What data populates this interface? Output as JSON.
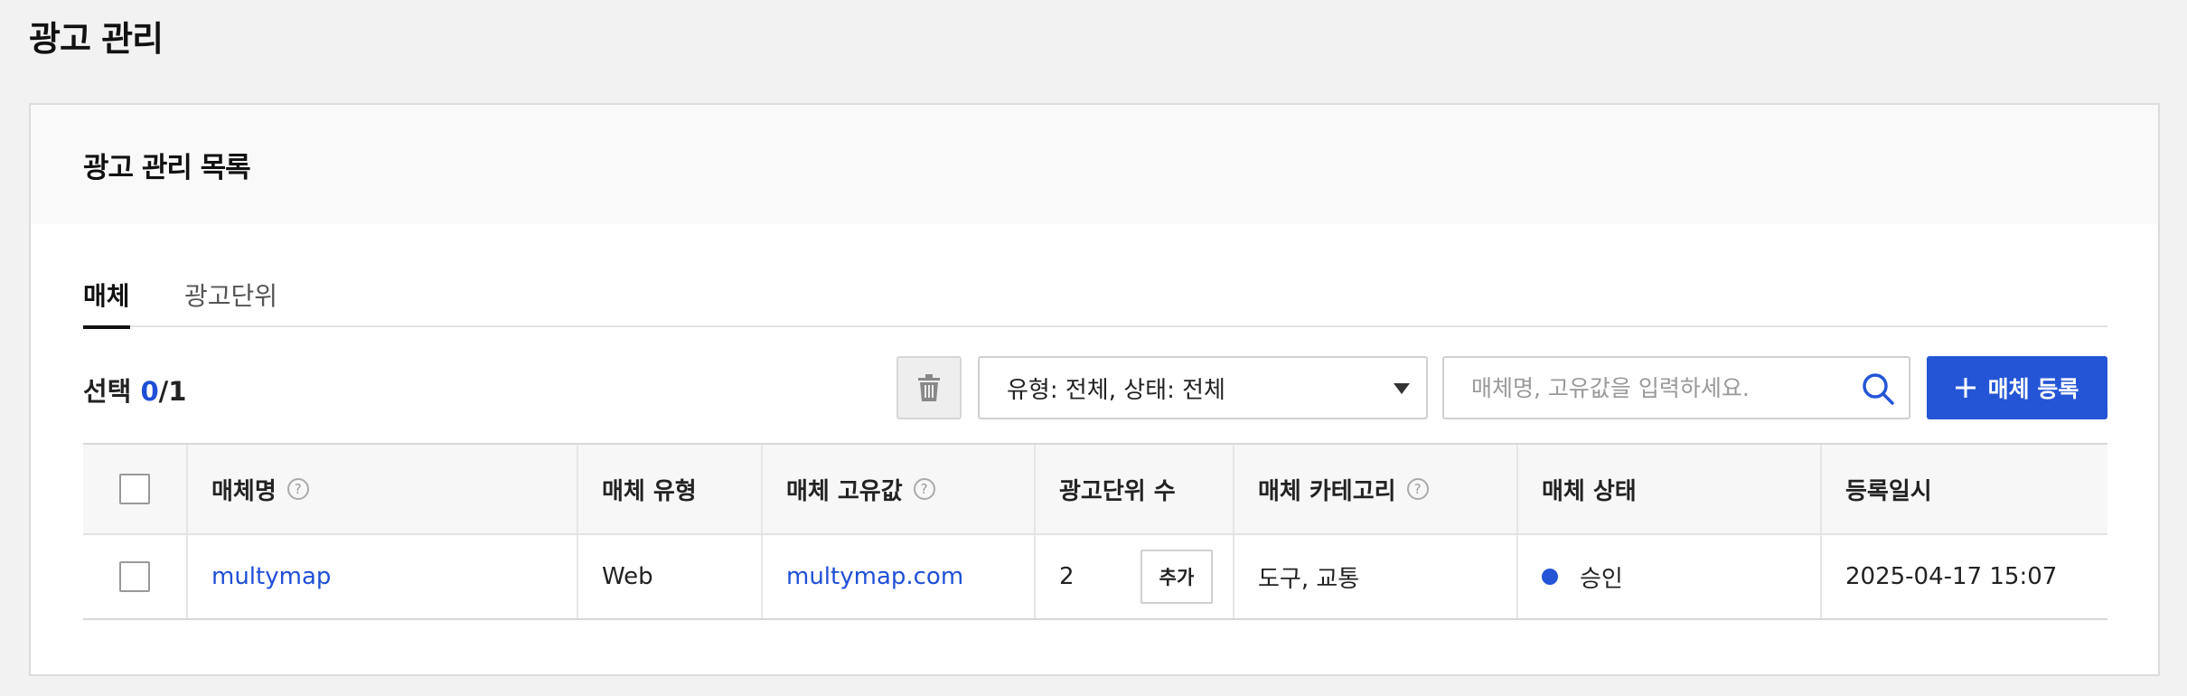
{
  "page": {
    "title": "광고 관리"
  },
  "card": {
    "title": "광고 관리 목록"
  },
  "tabs": [
    {
      "label": "매체",
      "active": true
    },
    {
      "label": "광고단위",
      "active": false
    }
  ],
  "toolbar": {
    "selection_label": "선택",
    "selected": "0",
    "total": "/1",
    "filter_value": "유형: 전체, 상태: 전체",
    "search_placeholder": "매체명, 고유값을 입력하세요.",
    "add_label": "매체 등록",
    "icons": {
      "delete": "trash-icon",
      "search": "search-icon",
      "add": "plus-icon",
      "dropdown": "caret-down-icon"
    }
  },
  "table": {
    "columns": [
      {
        "label": "매체명",
        "help": true
      },
      {
        "label": "매체 유형",
        "help": false
      },
      {
        "label": "매체 고유값",
        "help": true
      },
      {
        "label": "광고단위 수",
        "help": false
      },
      {
        "label": "매체 카테고리",
        "help": true
      },
      {
        "label": "매체 상태",
        "help": false
      },
      {
        "label": "등록일시",
        "help": false
      }
    ],
    "rows": [
      {
        "name": "multymap",
        "type": "Web",
        "unique_value": "multymap.com",
        "ad_unit_count": "2",
        "add_label": "추가",
        "category": "도구, 교통",
        "status": "승인",
        "status_color": "#2455d6",
        "registered_at": "2025-04-17 15:07"
      }
    ]
  },
  "colors": {
    "accent": "#2455d6",
    "link": "#1f4fd6"
  }
}
